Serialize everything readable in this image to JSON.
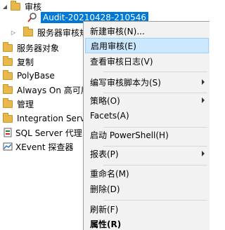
{
  "tree": {
    "audit_folder": "审核",
    "audit_item": "Audit-20210428-210546",
    "server_audit_spec": "服务器审核规范",
    "server_objects": "服务器对象",
    "replication": "复制",
    "polybase": "PolyBase",
    "always_on": "Always On 高可用",
    "management": "管理",
    "integration_services": "Integration Servic",
    "sql_agent": "SQL Server 代理",
    "xevent_profiler": "XEvent 探查器"
  },
  "context_menu": {
    "new_audit": "新建审核(N)...",
    "enable_audit": "启用审核(E)",
    "view_audit_logs": "查看审核日志(V)",
    "script_audit_as": "编写审核脚本为(S)",
    "policies": "策略(O)",
    "facets": "Facets(A)",
    "start_powershell": "启动 PowerShell(H)",
    "reports": "报表(P)",
    "rename": "重命名(M)",
    "delete": "删除(D)",
    "refresh": "刷新(F)",
    "properties": "属性(R)"
  },
  "colors": {
    "selection": "#0078d7",
    "menu_highlight": "#cce8ff",
    "folder": "#e8b94a"
  }
}
